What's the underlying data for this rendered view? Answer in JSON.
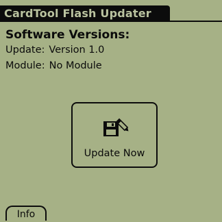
{
  "app": {
    "title": "CardTool Flash Updater"
  },
  "versions": {
    "heading": "Software Versions:",
    "update_label": "Update:",
    "update_value": "Version 1.0",
    "module_label": "Module:",
    "module_value": "No Module"
  },
  "actions": {
    "update_now_label": "Update Now",
    "update_now_icon": "floppy-disk-pencil-icon",
    "info_label": "Info"
  },
  "colors": {
    "screen_background": "#a6b186",
    "foreground": "#0c0c0c",
    "title_text": "#b9c29f"
  }
}
